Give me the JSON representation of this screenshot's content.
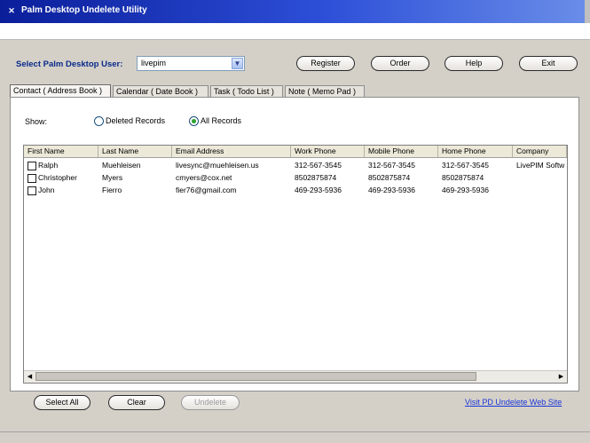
{
  "window": {
    "title": "Palm Desktop Undelete Utility"
  },
  "user_select": {
    "label": "Select Palm Desktop User:",
    "value": "livepim"
  },
  "top_buttons": {
    "register": "Register",
    "order": "Order",
    "help": "Help",
    "exit": "Exit"
  },
  "tabs": [
    {
      "label": "Contact ( Address Book )"
    },
    {
      "label": "Calendar ( Date Book )"
    },
    {
      "label": "Task ( Todo List )"
    },
    {
      "label": "Note ( Memo Pad )"
    }
  ],
  "show": {
    "label": "Show:",
    "deleted": "Deleted Records",
    "all": "All Records",
    "selected": "all"
  },
  "table": {
    "columns": [
      "First Name",
      "Last Name",
      "Email Address",
      "Work Phone",
      "Mobile Phone",
      "Home Phone",
      "Company"
    ],
    "rows": [
      {
        "first": "Ralph",
        "last": "Muehleisen",
        "email": "livesync@muehleisen.us",
        "work": "312-567-3545",
        "mobile": "312-567-3545",
        "home": "312-567-3545",
        "company": "LivePIM Softw"
      },
      {
        "first": "Christopher",
        "last": "Myers",
        "email": "cmyers@cox.net",
        "work": "8502875874",
        "mobile": "8502875874",
        "home": "8502875874",
        "company": ""
      },
      {
        "first": "John",
        "last": "Fierro",
        "email": "fier76@gmail.com",
        "work": "469-293-5936",
        "mobile": "469-293-5936",
        "home": "469-293-5936",
        "company": ""
      }
    ]
  },
  "bottom_buttons": {
    "select_all": "Select All",
    "clear": "Clear",
    "undelete": "Undelete"
  },
  "link": {
    "text": "Visit PD Undelete Web Site"
  }
}
